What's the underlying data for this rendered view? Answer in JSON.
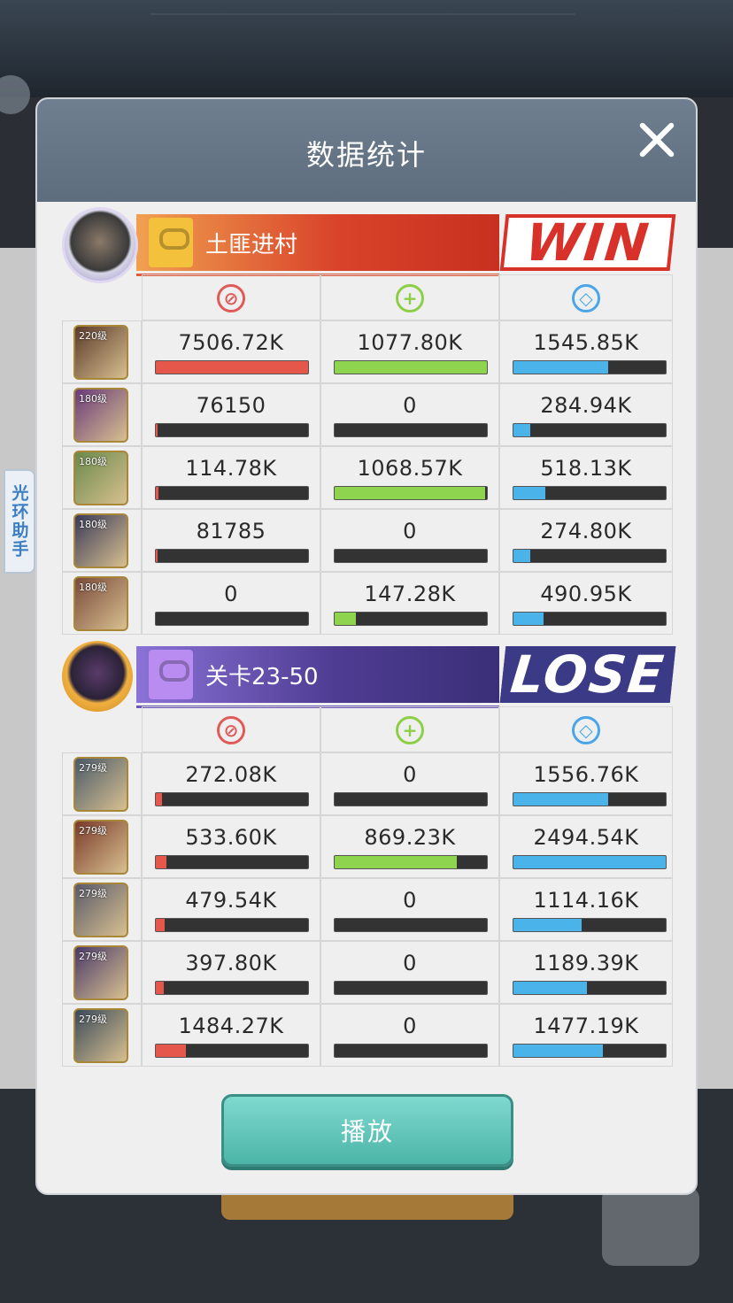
{
  "background": {
    "colors": {
      "dim": "#2b2f35"
    }
  },
  "side_tab": {
    "label": "光环助手"
  },
  "panel": {
    "title": "数据统计"
  },
  "stat_icons": {
    "damage": "damage-icon",
    "heal": "heal-icon",
    "tank": "shield-icon"
  },
  "team1": {
    "name": "土匪进村",
    "result": "WIN",
    "heroes": [
      {
        "level": "220级",
        "damage": "7506.72K",
        "heal": "1077.80K",
        "tank": "1545.85K",
        "damage_pct": 100,
        "heal_pct": 100,
        "tank_pct": 62
      },
      {
        "level": "180级",
        "damage": "76150",
        "heal": "0",
        "tank": "284.94K",
        "damage_pct": 1,
        "heal_pct": 0,
        "tank_pct": 11
      },
      {
        "level": "180级",
        "damage": "114.78K",
        "heal": "1068.57K",
        "tank": "518.13K",
        "damage_pct": 2,
        "heal_pct": 99,
        "tank_pct": 21
      },
      {
        "level": "180级",
        "damage": "81785",
        "heal": "0",
        "tank": "274.80K",
        "damage_pct": 1,
        "heal_pct": 0,
        "tank_pct": 11
      },
      {
        "level": "180级",
        "damage": "0",
        "heal": "147.28K",
        "tank": "490.95K",
        "damage_pct": 0,
        "heal_pct": 14,
        "tank_pct": 20
      }
    ]
  },
  "team2": {
    "name": "关卡23-50",
    "result": "LOSE",
    "heroes": [
      {
        "level": "279级",
        "damage": "272.08K",
        "heal": "0",
        "tank": "1556.76K",
        "damage_pct": 4,
        "heal_pct": 0,
        "tank_pct": 62
      },
      {
        "level": "279级",
        "damage": "533.60K",
        "heal": "869.23K",
        "tank": "2494.54K",
        "damage_pct": 7,
        "heal_pct": 80,
        "tank_pct": 100
      },
      {
        "level": "279级",
        "damage": "479.54K",
        "heal": "0",
        "tank": "1114.16K",
        "damage_pct": 6,
        "heal_pct": 0,
        "tank_pct": 45
      },
      {
        "level": "279级",
        "damage": "397.80K",
        "heal": "0",
        "tank": "1189.39K",
        "damage_pct": 5,
        "heal_pct": 0,
        "tank_pct": 48
      },
      {
        "level": "279级",
        "damage": "1484.27K",
        "heal": "0",
        "tank": "1477.19K",
        "damage_pct": 20,
        "heal_pct": 0,
        "tank_pct": 59
      }
    ]
  },
  "play_button": {
    "label": "播放"
  },
  "colors": {
    "damage": "#e5574a",
    "heal": "#8fd44e",
    "tank": "#4ab3ea",
    "win": "#d8312a",
    "lose_bg": "#3b3a86",
    "play": "#5cc4b8"
  }
}
